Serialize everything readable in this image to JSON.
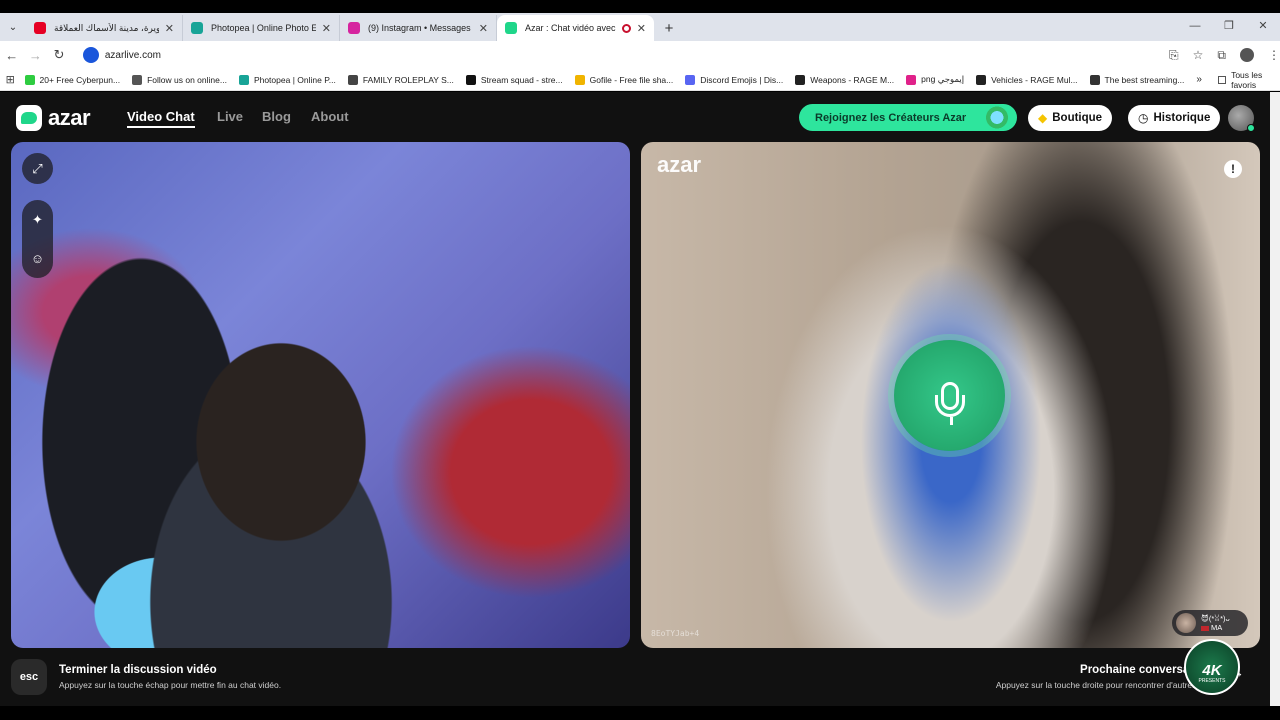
{
  "browser": {
    "tabs": [
      {
        "title": "الصويرة، مدينة الأسماك العملاقة",
        "favicon_color": "#e60023",
        "active": false
      },
      {
        "title": "Photopea | Online Photo Editor",
        "favicon_color": "#18a497",
        "active": false
      },
      {
        "title": "(9) Instagram • Messages",
        "favicon_color": "#d6249f",
        "active": false
      },
      {
        "title": "Azar : Chat vidéo avec de n",
        "favicon_color": "#1fd68a",
        "active": true
      }
    ],
    "url": "azarlive.com",
    "bookmarks": [
      {
        "label": "20+ Free Cyberpun...",
        "color": "#2ecc40"
      },
      {
        "label": "Follow us on online...",
        "color": "#555555"
      },
      {
        "label": "Photopea | Online P...",
        "color": "#18a497"
      },
      {
        "label": "FAMILY ROLEPLAY S...",
        "color": "#444444"
      },
      {
        "label": "Stream squad - stre...",
        "color": "#111111"
      },
      {
        "label": "Gofile - Free file sha...",
        "color": "#f0b400"
      },
      {
        "label": "Discord Emojis | Dis...",
        "color": "#5865f2"
      },
      {
        "label": "Weapons - RAGE M...",
        "color": "#222222"
      },
      {
        "label": "png إيموجي",
        "color": "#e0218a"
      },
      {
        "label": "Vehicles - RAGE Mul...",
        "color": "#222222"
      },
      {
        "label": "The best streaming...",
        "color": "#333333"
      }
    ],
    "all_bookmarks": "Tous les favoris"
  },
  "site": {
    "logo_text": "azar",
    "nav": [
      "Video Chat",
      "Live",
      "Blog",
      "About"
    ],
    "creators_button": "Rejoignez les Créateurs Azar",
    "shop_button": "Boutique",
    "history_button": "Historique"
  },
  "remote": {
    "watermark": "azar",
    "report_icon": "!",
    "id_watermark": "8EoTYJab+4",
    "peer_name": "😈(*ꈍ*)ᴗ",
    "peer_country": "MA"
  },
  "footer": {
    "esc_key": "esc",
    "end_title": "Terminer la discussion vidéo",
    "end_sub": "Appuyez sur la touche échap pour mettre fin au chat vidéo.",
    "next_title": "Prochaine conversation v",
    "next_sub": "Appuyez sur la touche droite pour rencontrer d'autres perso",
    "badge_main": "4K",
    "badge_sub": "PRESENTS"
  },
  "colors": {
    "accent": "#2ee59d",
    "background": "#111111",
    "mic": "#25a96e"
  }
}
